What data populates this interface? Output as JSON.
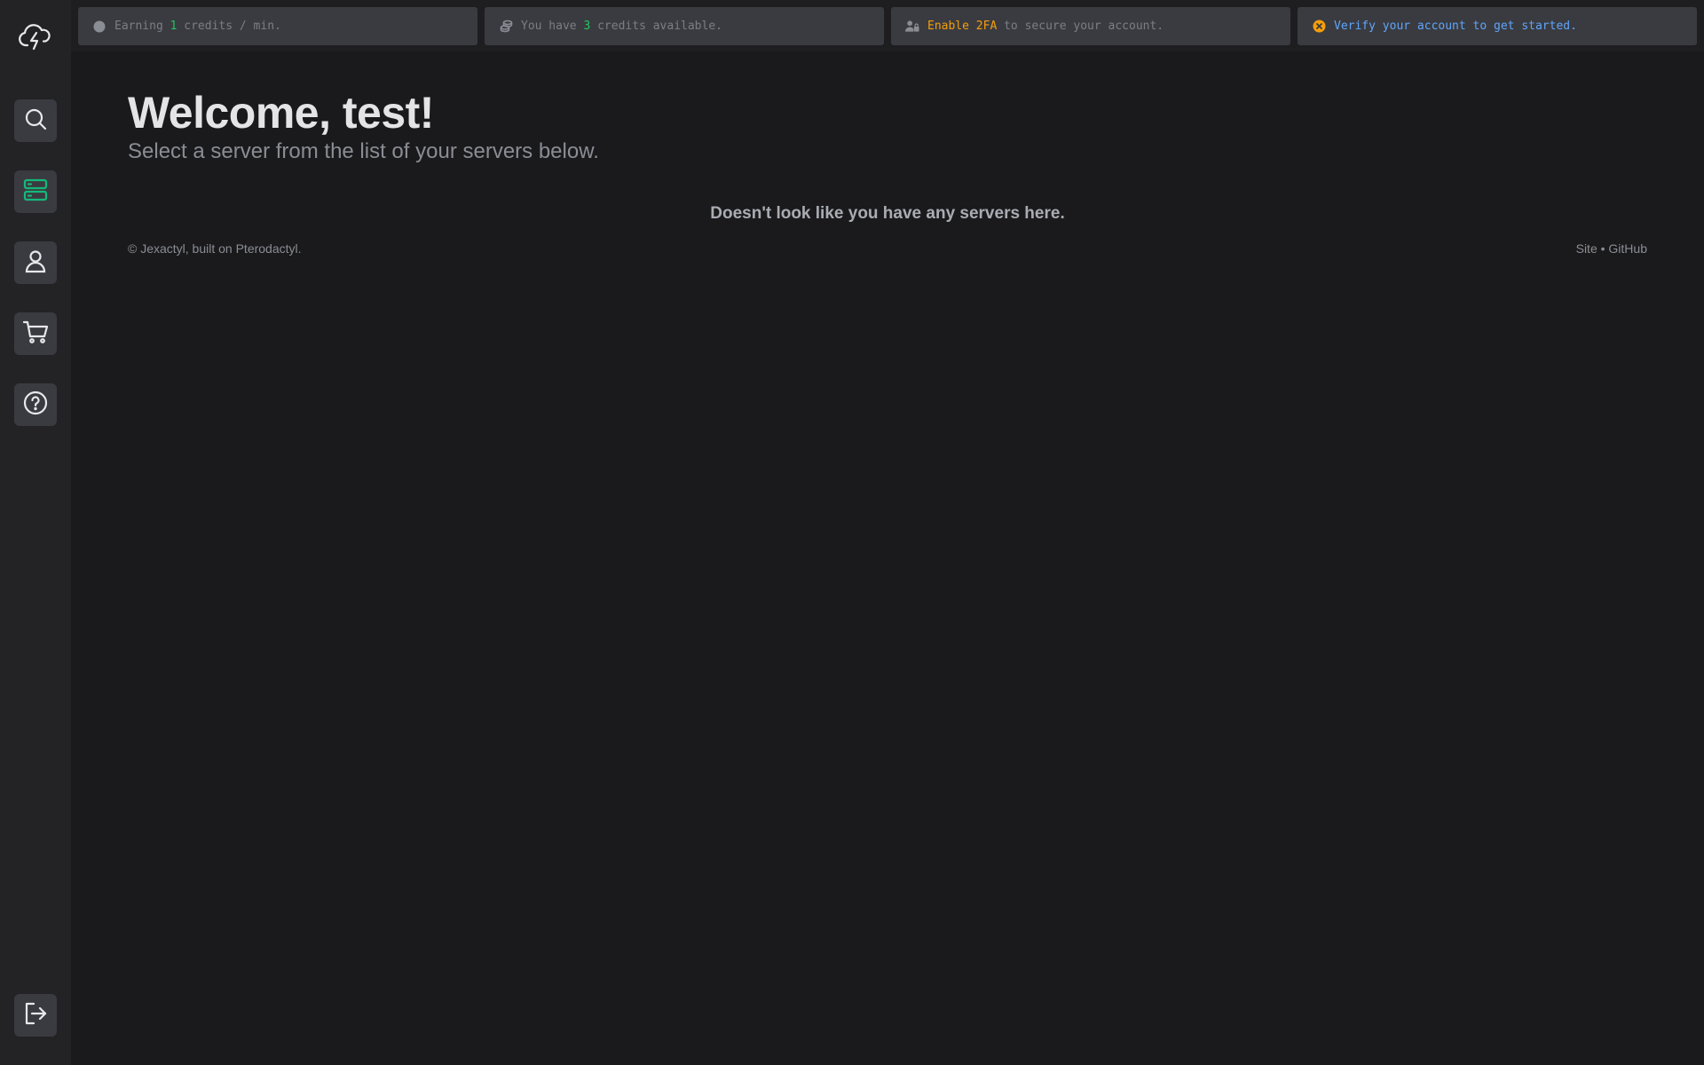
{
  "colors": {
    "background": "#1a1a1c",
    "sidebar": "#232326",
    "button": "#3a3b40",
    "accent_green": "#22c55e",
    "active_icon": "#14b87a",
    "warning": "#f59e0b",
    "link_blue": "#60a5fa",
    "muted": "#7b7e85"
  },
  "sidebar": {
    "logo_icon": "cloud-lightning-icon",
    "items": [
      {
        "icon": "search-icon",
        "label": "Search"
      },
      {
        "icon": "server-icon",
        "label": "Servers",
        "active": true
      },
      {
        "icon": "user-icon",
        "label": "Account"
      },
      {
        "icon": "cart-icon",
        "label": "Store"
      },
      {
        "icon": "help-icon",
        "label": "Help"
      }
    ],
    "logout_icon": "logout-icon"
  },
  "topbar": {
    "earning": {
      "pre": "Earning ",
      "value": "1",
      "post": " credits / min."
    },
    "credits": {
      "pre": "You have ",
      "value": "3",
      "post": " credits available."
    },
    "twofa": {
      "highlight": "Enable 2FA",
      "post": " to secure your account."
    },
    "verify": {
      "text": "Verify your account to get started."
    }
  },
  "main": {
    "title": "Welcome, test!",
    "subtitle": "Select a server from the list of your servers below.",
    "empty_message": "Doesn't look like you have any servers here."
  },
  "footer": {
    "copyright": "© Jexactyl, built on Pterodactyl.",
    "site_link": "Site",
    "separator": " • ",
    "github_link": "GitHub"
  }
}
